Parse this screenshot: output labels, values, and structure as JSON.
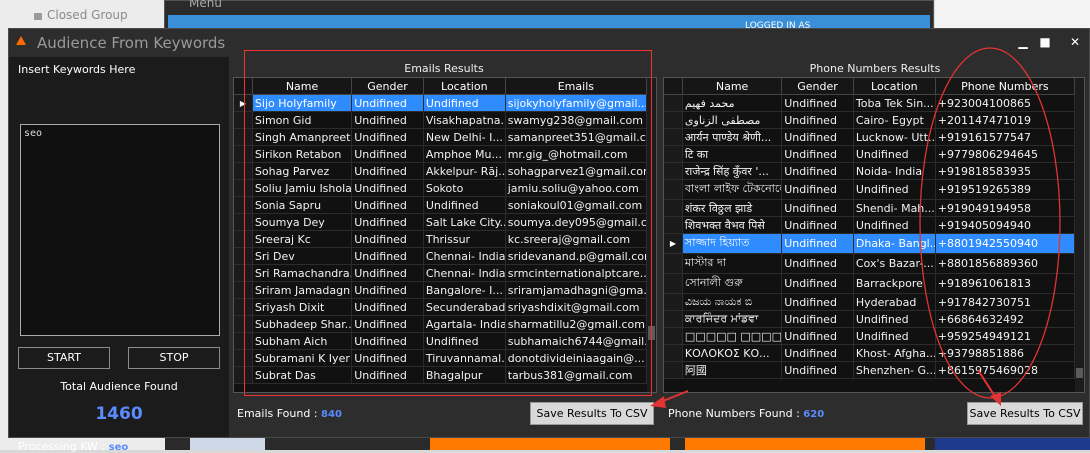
{
  "background": {
    "closed_group": "Closed Group",
    "menu_title": "Menu",
    "logged_text": "LOGGED IN AS"
  },
  "window": {
    "title": "Audience From Keywords",
    "minimize": "▁",
    "maximize": "■",
    "close": "✕"
  },
  "left": {
    "insert_label": "Insert Keywords Here",
    "keywords": "seo",
    "start_label": "START",
    "stop_label": "STOP",
    "total_label": "Total Audience Found",
    "total_count": "1460",
    "processing_label": "Processing KW :",
    "processing_kw": "seo"
  },
  "emails": {
    "title": "Emails Results",
    "columns": [
      "Name",
      "Gender",
      "Location",
      "Emails"
    ],
    "rows": [
      [
        "Sijo Holyfamily",
        "Undifined",
        "Undifined",
        "sijokyholyfamily@gmail...."
      ],
      [
        "Simon Gid",
        "Undifined",
        "Visakhapatna...",
        "swamyg238@gmail.com"
      ],
      [
        "Singh Amanpreet",
        "Undifined",
        "New Delhi- I...",
        "samanpreet351@gmail.c..."
      ],
      [
        "Sirikon Retabon",
        "Undifined",
        "Amphoe Mu...",
        "mr.gig_@hotmail.com"
      ],
      [
        "Sohag Parvez",
        "Undifined",
        "Akkelpur- Rāj...",
        "sohagparvez1@gmail.com"
      ],
      [
        "Soliu Jamiu Ishola",
        "Undifined",
        "Sokoto",
        "jamiu.soliu@yahoo.com"
      ],
      [
        "Sonia Sapru",
        "Undifined",
        "Undifined",
        "soniakoul01@gmail.com"
      ],
      [
        "Soumya Dey",
        "Undifined",
        "Salt Lake City...",
        "soumya.dey095@gmail.c..."
      ],
      [
        "Sreeraj Kc",
        "Undifined",
        "Thrissur",
        "kc.sreeraj@gmail.com"
      ],
      [
        "Sri Dev",
        "Undifined",
        "Chennai- India",
        "sridevanand.p@gmail.com"
      ],
      [
        "Sri Ramachandra...",
        "Undifined",
        "Chennai- India",
        "srmcinternationalptcare..."
      ],
      [
        "Sriram Jamadagni",
        "Undifined",
        "Bangalore- I...",
        "sriramjamadhagni@gma..."
      ],
      [
        "Sriyash Dixit",
        "Undifined",
        "Secunderabad",
        "sriyashdixit@gmail.com"
      ],
      [
        "Subhadeep Shar...",
        "Undifined",
        "Agartala- India",
        "sharmatillu2@gmail.com"
      ],
      [
        "Subham Aich",
        "Undifined",
        "Undifined",
        "subhamaich6744@gmail..."
      ],
      [
        "Subramani K Iyer",
        "Undifined",
        "Tiruvannamal...",
        "donotdivideiniaagain@..."
      ],
      [
        "Subrat Das",
        "Undifined",
        "Bhagalpur",
        "tarbus381@gmail.com"
      ]
    ],
    "found_label": "Emails Found :",
    "found_count": "840",
    "save_label": "Save Results To CSV"
  },
  "phones": {
    "title": "Phone Numbers Results",
    "columns": [
      "Name",
      "Gender",
      "Location",
      "Phone Numbers"
    ],
    "rows": [
      [
        "محمد فهيم",
        "Undifined",
        "Toba Tek Sin...",
        "+923004100865"
      ],
      [
        "مصطفى الزناوى",
        "Undifined",
        "Cairo- Egypt",
        "+201147471019"
      ],
      [
        "आर्यन पाण्डेय श्रेणी...",
        "Undifined",
        "Lucknow- Utt...",
        "+919161577547"
      ],
      [
        "टि का",
        "Undifined",
        "Undifined",
        "+9779806294645"
      ],
      [
        "राजेन्द्र सिंह कुँवर '...",
        "Undifined",
        "Noida- India",
        "+919818583935"
      ],
      [
        "বাংলা লাইফ টেকনোলো...",
        "Undifined",
        "Undifined",
        "+919519265389"
      ],
      [
        "शंकर विठ्ठल झाडे",
        "Undifined",
        "Shendi- Mah...",
        "+919049194958"
      ],
      [
        "शिवभक्त वैभव पिसे",
        "Undifined",
        "Undifined",
        "+919405094940"
      ],
      [
        "সাজ্জাদ হিয়্যাত",
        "Undifined",
        "Dhaka- Bangl...",
        "+8801942550940"
      ],
      [
        "মাস্টার দা",
        "Undifined",
        "Cox's Bazar-...",
        "+8801856889360"
      ],
      [
        "সোনালী গুরু",
        "Undifined",
        "Barrackpore",
        "+918961061813"
      ],
      [
        "ವಿಜಯ ನಾಯಕ ಬಿ",
        "Undifined",
        "Hyderabad",
        "+917842730751"
      ],
      [
        "ਕਾਰਜਿੰਦਰ ਮਾਂਡਵਾ",
        "Undifined",
        "Undifined",
        "+66864632492"
      ],
      [
        "□□□□□ □□□□",
        "Undifined",
        "Undifined",
        "+959254949121"
      ],
      [
        "ΚΟΛΟΚΟΣ ΚΟ...",
        "Undifined",
        "Khost- Afgha...",
        "+93798851886"
      ],
      [
        "阿國",
        "Undifined",
        "Shenzhen- G...",
        "+8615975469028"
      ]
    ],
    "found_label": "Phone Numbers Found :",
    "found_count": "620",
    "save_label": "Save Results To CSV"
  },
  "colors": {
    "window_bg": "#2d2d2d",
    "selection": "#2f8cff",
    "accent_count": "#5a8cff",
    "annotation_red": "#e33333"
  }
}
